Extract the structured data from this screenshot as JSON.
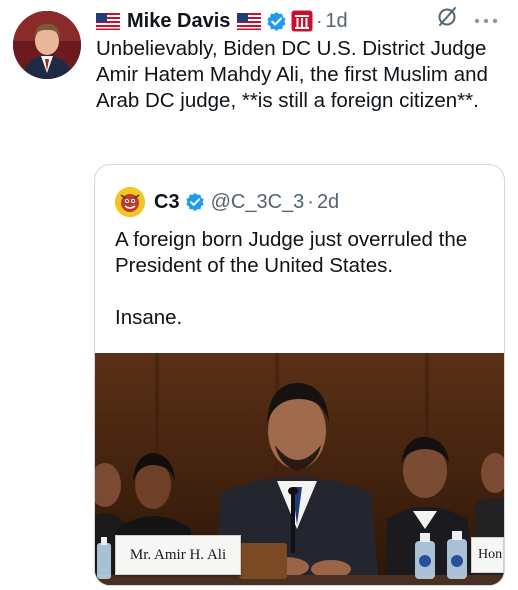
{
  "tweet": {
    "author_name": "Mike Davis",
    "time": "1d",
    "separator": "·",
    "text": "Unbelievably, Biden DC U.S. District Judge Amir Hatem Mahdy Ali, the first Muslim and Arab DC judge, **is still a foreign citizen**.",
    "icons": {
      "flag": "us-flag-icon",
      "verified": "verified-badge-icon",
      "affiliate": "affiliate-badge-icon",
      "grok": "grok-icon",
      "more": "more-icon"
    }
  },
  "quoted_tweet": {
    "author_name": "C3",
    "handle": "@C_3C_3",
    "time": "2d",
    "separator": "·",
    "text": "A foreign born Judge just overruled the President of the United States.\n\nInsane.",
    "image": {
      "nameplate": "Mr. Amir H. Ali",
      "nameplate_right": "Hon"
    }
  },
  "colors": {
    "verified_blue": "#1d9bf0",
    "muted_text": "#536471",
    "border": "#cfd9de",
    "affiliate_red": "#c8102e"
  }
}
